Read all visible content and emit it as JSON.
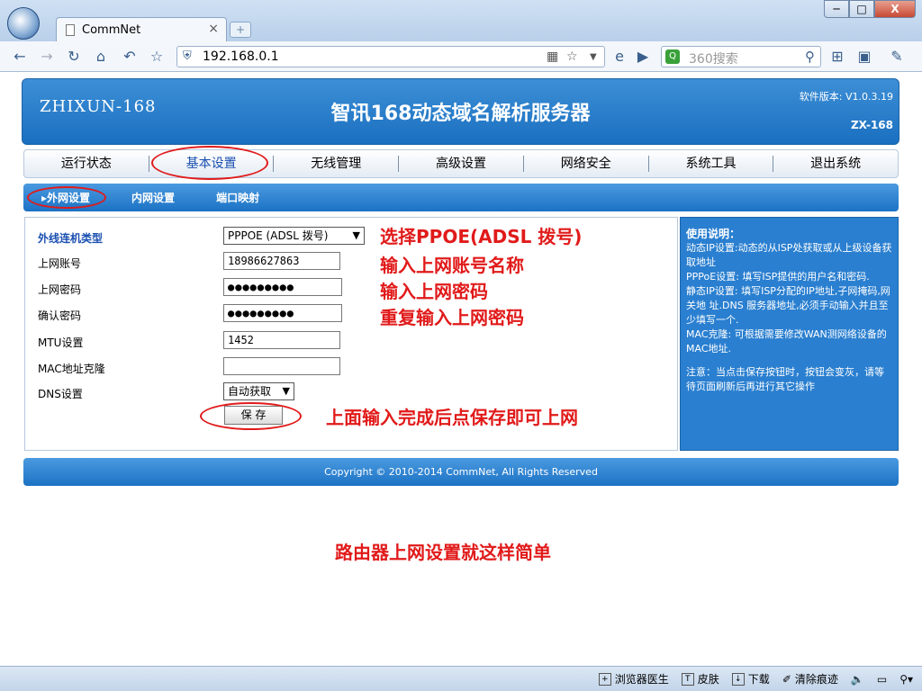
{
  "browser": {
    "tab_title": "CommNet",
    "tab_close": "×",
    "new_tab": "+",
    "url": "192.168.0.1",
    "search_placeholder": "360搜索",
    "win_min": "─",
    "win_max": "□",
    "win_close": "X"
  },
  "header": {
    "brand": "ZHIXUN-168",
    "title": "智讯168动态域名解析服务器",
    "version": "软件版本: V1.0.3.19",
    "model": "ZX-168"
  },
  "nav": {
    "items": [
      "运行状态",
      "基本设置",
      "无线管理",
      "高级设置",
      "网络安全",
      "系统工具",
      "退出系统"
    ]
  },
  "subnav": {
    "items": [
      "外网设置",
      "内网设置",
      "端口映射"
    ]
  },
  "form": {
    "wan_type_label": "外线连机类型",
    "wan_type_value": "PPPOE (ADSL 拨号)",
    "account_label": "上网账号",
    "account_value": "18986627863",
    "password_label": "上网密码",
    "password_value": "●●●●●●●●●",
    "confirm_label": "确认密码",
    "confirm_value": "●●●●●●●●●",
    "mtu_label": "MTU设置",
    "mtu_value": "1452",
    "mac_label": "MAC地址克隆",
    "mac_value": "",
    "dns_label": "DNS设置",
    "dns_value": "自动获取",
    "save_label": "保 存"
  },
  "help": {
    "title": "使用说明：",
    "p1": "动态IP设置:动态的从ISP处获取或从上级设备获取地址",
    "p2": "PPPoE设置: 填写ISP提供的用户名和密码.",
    "p3": "静态IP设置: 填写ISP分配的IP地址,子网掩码,网关地 址.DNS 服务器地址,必须手动输入并且至少填写一个.",
    "p4": "MAC克隆: 可根据需要修改WAN测网络设备的MAC地址.",
    "p5": "注意：当点击保存按钮时，按钮会变灰，请等待页面刷新后再进行其它操作"
  },
  "footer": {
    "text": "Copyright © 2010-2014 CommNet, All Rights Reserved"
  },
  "annotations": {
    "n1": "选择PPOE(ADSL 拨号)",
    "n2": "输入上网账号名称",
    "n3": "输入上网密码",
    "n4": "重复输入上网密码",
    "n5": "上面输入完成后点保存即可上网",
    "n6": "路由器上网设置就这样简单"
  },
  "statusbar": {
    "items": [
      "浏览器医生",
      "皮肤",
      "下载",
      "清除痕迹"
    ]
  },
  "colors": {
    "accent": "#1c72c4",
    "annotation": "#e11a1a"
  }
}
